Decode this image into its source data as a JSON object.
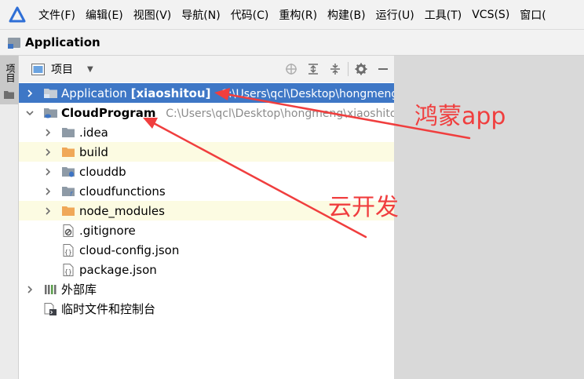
{
  "menubar": {
    "items": [
      "文件(F)",
      "编辑(E)",
      "视图(V)",
      "导航(N)",
      "代码(C)",
      "重构(R)",
      "构建(B)",
      "运行(U)",
      "工具(T)",
      "VCS(S)",
      "窗口("
    ]
  },
  "navbar": {
    "title": "Application"
  },
  "tool_strip": {
    "label": "项目"
  },
  "panel": {
    "title": "项目",
    "tools": [
      "target-icon",
      "expand-all-icon",
      "collapse-all-icon",
      "gear-icon",
      "minimize-icon"
    ]
  },
  "tree": {
    "application": {
      "name": "Application",
      "module": "[xiaoshitou]",
      "path": "C:\\Users\\qcl\\Desktop\\hongmeng"
    },
    "cloud_program": {
      "name": "CloudProgram",
      "path": "C:\\Users\\qcl\\Desktop\\hongmeng\\xiaoshitou"
    },
    "children": [
      ".idea",
      "build",
      "clouddb",
      "cloudfunctions",
      "node_modules"
    ],
    "files": [
      ".gitignore",
      "cloud-config.json",
      "package.json"
    ],
    "external_libs": "外部库",
    "scratches": "临时文件和控制台"
  },
  "annotations": {
    "harmony_app": "鸿蒙app",
    "cloud_dev": "云开发",
    "color": "#f03e3e"
  }
}
